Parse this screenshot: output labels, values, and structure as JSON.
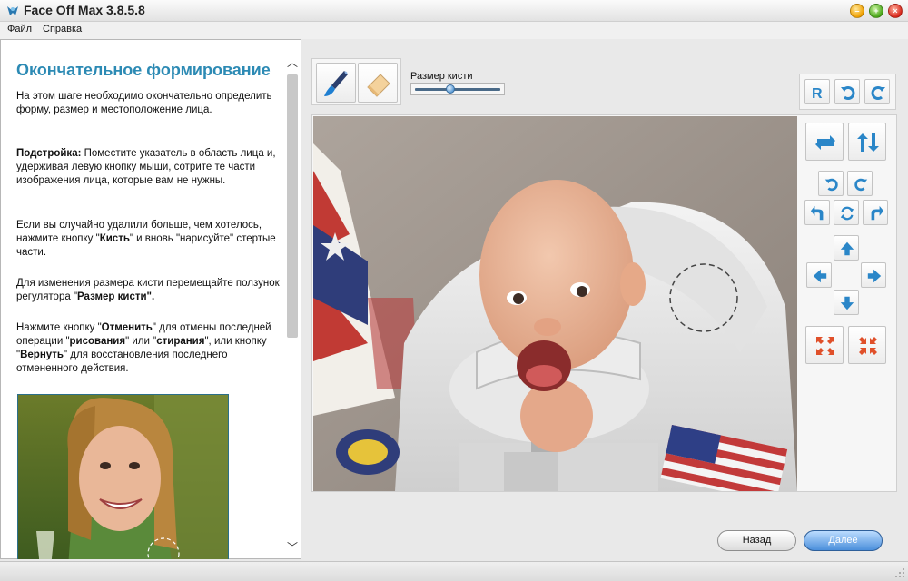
{
  "window": {
    "title": "Face Off Max  3.8.5.8"
  },
  "menu": {
    "items": [
      "Файл",
      "Справка"
    ]
  },
  "help": {
    "title": "Окончательное формирование",
    "p1": "На этом шаге необходимо окончательно определить форму, размер и местоположение лица.",
    "p2_bold": "Подстройка:",
    "p2_text": " Поместите указатель в область лица и, удерживая левую кнопку мыши, сотрите те части изображения лица, которые вам не нужны.",
    "p3_a": "Если вы случайно удалили больше, чем хотелось, нажмите кнопку \"",
    "p3_b": "Кисть",
    "p3_c": "\" и вновь \"нарисуйте\" стертые части.",
    "p4_a": "Для изменения размера кисти перемещайте ползунок регулятора \"",
    "p4_b": "Размер кисти\".",
    "p5_a": "Нажмите кнопку \"",
    "p5_b": "Отменить",
    "p5_c": "\" для отмены последней операции \"",
    "p5_d": "рисования",
    "p5_e": "\" или \"",
    "p5_f": "стирания",
    "p5_g": "\", или кнопку \"",
    "p5_h": "Вернуть",
    "p5_i": "\" для восстановления последнего отмененного действия."
  },
  "toolbar": {
    "brush_size_label": "Размер кисти",
    "brush_size_value": 0.4
  },
  "icons": {
    "reset": "reset-icon",
    "undo": "undo-icon",
    "redo": "redo-icon"
  },
  "buttons": {
    "back": "Назад",
    "next": "Далее"
  },
  "colors": {
    "accent": "#2c8ab4",
    "primary_button": "#4b8fdb",
    "icon_blue": "#2a86c8",
    "icon_orange": "#e0502a"
  }
}
